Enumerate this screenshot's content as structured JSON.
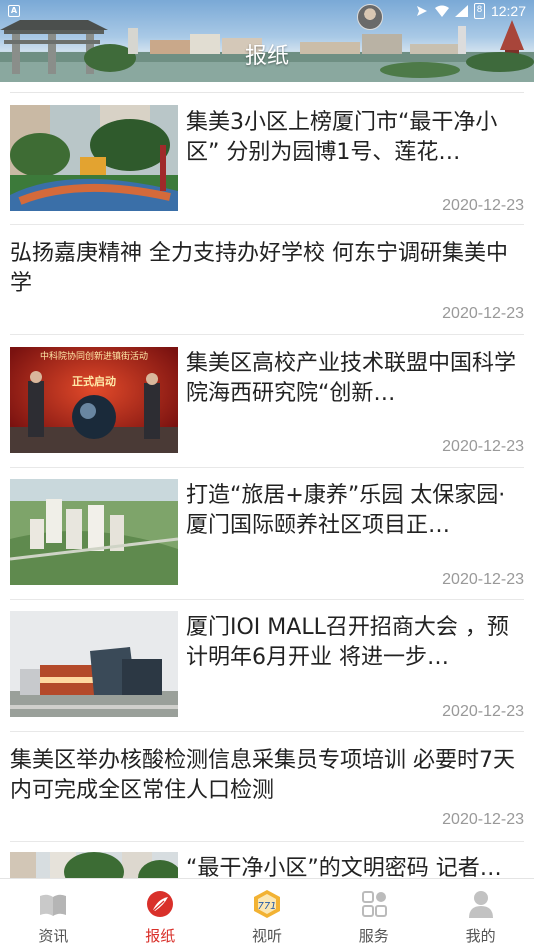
{
  "status_bar": {
    "time": "12:27",
    "battery": "8"
  },
  "header": {
    "title": "报纸"
  },
  "articles": [
    {
      "title": "集美3小区上榜厦门市“最干净小区” 分别为园博1号、莲花…",
      "date": "2020-12-23",
      "image": "residential-garden-photo"
    },
    {
      "title": "弘扬嘉庚精神 全力支持办好学校 何东宁调研集美中学",
      "date": "2020-12-23"
    },
    {
      "title": "集美区高校产业技术联盟中国科学院海西研究院“创新…",
      "date": "2020-12-23",
      "image": "launch-ceremony-photo",
      "image_text": [
        "中科院协同创新进镇街活动",
        "正式启动"
      ]
    },
    {
      "title": "打造“旅居+康养”乐园 太保家园·厦门国际颐养社区项目正…",
      "date": "2020-12-23",
      "image": "community-aerial-render"
    },
    {
      "title": "厦门IOI MALL召开招商大会 ，预计明年6月开业 将进一步…",
      "date": "2020-12-23",
      "image": "mall-building-photo"
    },
    {
      "title": "集美区举办核酸检测信息采集员专项培训  必要时7天内可完成全区常住人口检测",
      "date": "2020-12-23"
    },
    {
      "title": "“最干净小区”的文明密码 记者…",
      "date": "",
      "image": "residential-street-photo"
    }
  ],
  "nav": [
    {
      "label": "资讯",
      "icon": "book-icon",
      "active": false
    },
    {
      "label": "报纸",
      "icon": "newspaper-feather-icon",
      "active": true
    },
    {
      "label": "视听",
      "icon": "media-badge-icon",
      "active": false
    },
    {
      "label": "服务",
      "icon": "grid-apps-icon",
      "active": false
    },
    {
      "label": "我的",
      "icon": "person-icon",
      "active": false
    }
  ],
  "colors": {
    "accent": "#d9302a",
    "date": "#999999",
    "divider": "#e8e8e8"
  }
}
